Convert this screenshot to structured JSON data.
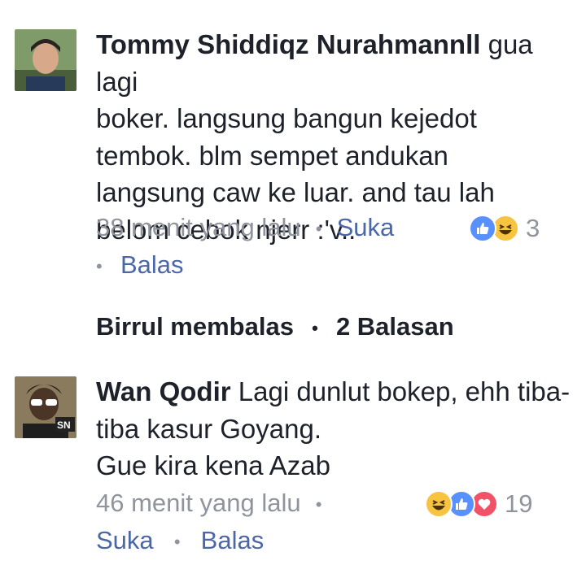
{
  "comments": [
    {
      "author": "Tommy Shiddiqz Nurahmannll",
      "text_line1": " gua lagi",
      "text_lines": [
        "boker. langsung bangun kejedot",
        "tembok. blm sempet andukan",
        "langsung caw ke luar. and tau lah",
        "belom cebok njerr :'v.."
      ],
      "time": "38 menit yang lalu",
      "like_label": "Suka",
      "reply_label": "Balas",
      "reaction_count": "3",
      "reactions": [
        "like-icon",
        "haha-icon"
      ]
    },
    {
      "author": "Wan Qodir",
      "text_line1": " Lagi dunlut bokep, ehh tiba-",
      "text_lines": [
        "tiba kasur Goyang.",
        "Gue kira kena Azab"
      ],
      "time": "46 menit yang lalu",
      "like_label": "Suka",
      "reply_label": "Balas",
      "reaction_count": "19",
      "reactions": [
        "haha-icon",
        "like-icon",
        "love-icon"
      ]
    }
  ],
  "replies_summary": {
    "replier": "Birrul membalas",
    "count_label": "2 Balasan"
  },
  "colors": {
    "text": "#1d2129",
    "meta": "#90949c",
    "link": "#4b67a8",
    "like_blue": "#5890ff",
    "haha_yellow": "#f7c442",
    "love_red": "#f25268"
  }
}
